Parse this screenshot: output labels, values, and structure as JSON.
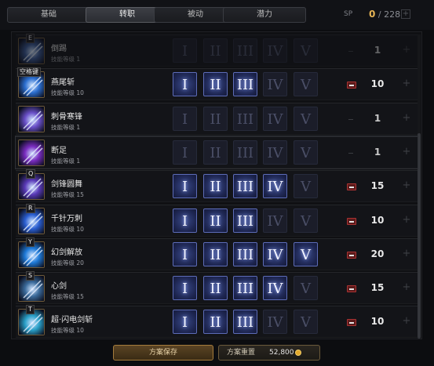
{
  "tabs": [
    {
      "label": "基础",
      "active": false
    },
    {
      "label": "转职",
      "active": true
    },
    {
      "label": "被动",
      "active": false
    },
    {
      "label": "潜力",
      "active": false
    }
  ],
  "sp": {
    "label": "SP",
    "current": "0",
    "separator": "/",
    "total": "228"
  },
  "tier_labels": [
    "I",
    "II",
    "III",
    "IV",
    "V"
  ],
  "skills": [
    {
      "name": "倒踢",
      "level_text": "技能等级 1",
      "key": "E",
      "tiers_unlocked": 0,
      "level": "1",
      "can_decrease": false,
      "faded": true,
      "icon": "kick-skill-icon",
      "color": "#3a5a9a"
    },
    {
      "name": "燕尾斩",
      "level_text": "技能等级 10",
      "key": "空格键",
      "tiers_unlocked": 3,
      "level": "10",
      "can_decrease": true,
      "faded": false,
      "icon": "swallowtail-slash-icon",
      "color": "#2c6fd0"
    },
    {
      "name": "刺骨寒锋",
      "level_text": "技能等级 1",
      "key": "",
      "tiers_unlocked": 0,
      "level": "1",
      "can_decrease": false,
      "faded": false,
      "icon": "frost-blade-icon",
      "color": "#6a50c8"
    },
    {
      "name": "断足",
      "level_text": "技能等级 1",
      "key": "",
      "tiers_unlocked": 0,
      "level": "1",
      "can_decrease": false,
      "faded": false,
      "icon": "leg-break-icon",
      "color": "#7a2cc0"
    },
    {
      "name": "剑锋圆舞",
      "level_text": "技能等级 15",
      "key": "Q",
      "tiers_unlocked": 4,
      "level": "15",
      "can_decrease": true,
      "faded": false,
      "icon": "blade-waltz-icon",
      "color": "#5a3ab8"
    },
    {
      "name": "千针万刺",
      "level_text": "技能等级 10",
      "key": "R",
      "tiers_unlocked": 3,
      "level": "10",
      "can_decrease": true,
      "faded": false,
      "icon": "thousand-stabs-icon",
      "color": "#2a5ed0"
    },
    {
      "name": "幻剑解放",
      "level_text": "技能等级 20",
      "key": "Y",
      "tiers_unlocked": 5,
      "level": "20",
      "can_decrease": true,
      "faded": false,
      "icon": "phantom-sword-icon",
      "color": "#1f7ad8"
    },
    {
      "name": "心剑",
      "level_text": "技能等级 15",
      "key": "S",
      "tiers_unlocked": 4,
      "level": "15",
      "can_decrease": true,
      "faded": false,
      "icon": "heart-sword-icon",
      "color": "#3a6a9a"
    },
    {
      "name": "超·闪电剑斩",
      "level_text": "技能等级 10",
      "key": "T",
      "tiers_unlocked": 3,
      "level": "10",
      "can_decrease": true,
      "faded": false,
      "icon": "lightning-sword-icon",
      "color": "#2aa0c8"
    }
  ],
  "buttons": {
    "save": "方案保存",
    "reset": "方案重置",
    "reset_cost": "52,800"
  },
  "colors": {
    "accent_gold": "#e6b455",
    "tier_on": "#3a4a8a",
    "minus_red": "#a33"
  }
}
